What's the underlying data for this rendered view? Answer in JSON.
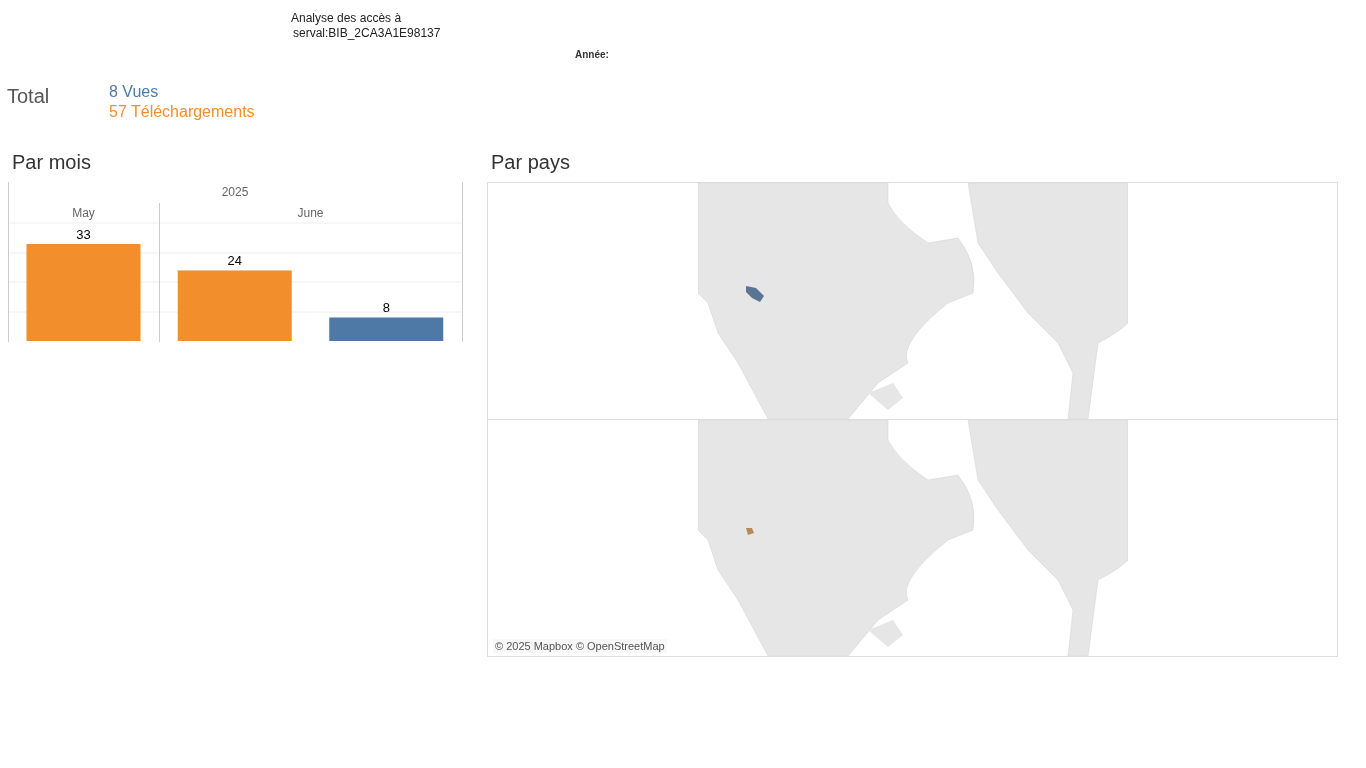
{
  "header": {
    "title_line_1": "Analyse des accès à",
    "title_line_2": "serval:BIB_2CA3A1E98137",
    "filter_label": "Année:"
  },
  "total": {
    "label": "Total",
    "views": "8 Vues",
    "downloads": "57 Téléchargements"
  },
  "by_month": {
    "title": "Par mois",
    "year": "2025",
    "chart_data": {
      "type": "bar",
      "categories": [
        "May",
        "June"
      ],
      "series": [
        {
          "color": "#f28e2b",
          "values": [
            33,
            24
          ]
        },
        {
          "color": "#4e79a7",
          "values": [
            null,
            8
          ]
        }
      ],
      "data_labels": true
    }
  },
  "by_country": {
    "title": "Par pays",
    "attribution": "© 2025 Mapbox © OpenStreetMap"
  }
}
